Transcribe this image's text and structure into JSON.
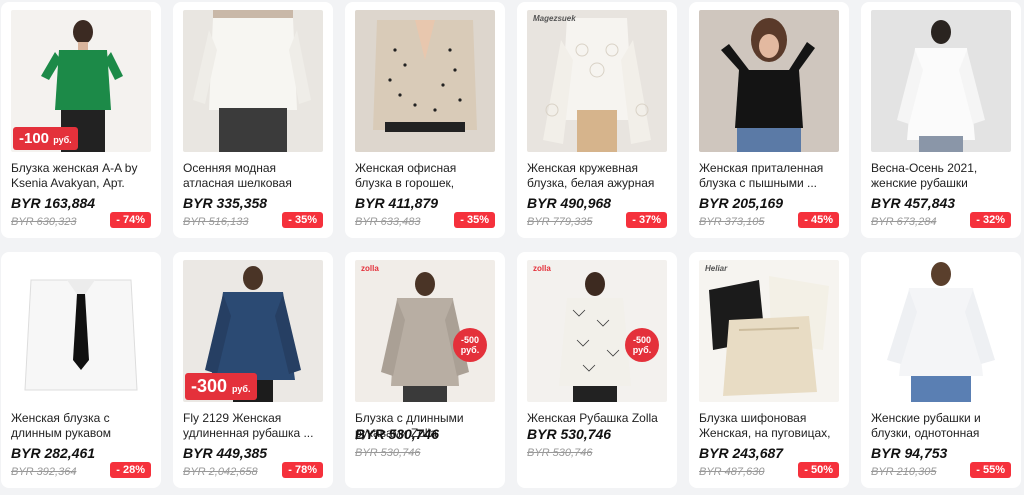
{
  "products": [
    {
      "title": "Блузка женская A-A by Ksenia Avakyan, Арт. ФА-...",
      "price": "BYR 163,884",
      "old_price": "BYR 630,323",
      "discount": "- 74%",
      "promo": "-100",
      "promo_sub": "руб."
    },
    {
      "title": "Осенняя модная атласная шелковая рубашка на ...",
      "price": "BYR 335,358",
      "old_price": "BYR 516,133",
      "discount": "- 35%"
    },
    {
      "title": "Женская офисная блузка в горошек, хлопковая ...",
      "price": "BYR 411,879",
      "old_price": "BYR 633,483",
      "discount": "- 35%"
    },
    {
      "title": "Женская кружевная блузка, белая ажурная блузка ...",
      "price": "BYR 490,968",
      "old_price": "BYR 779,335",
      "discount": "- 37%",
      "brand": "Magezsuek"
    },
    {
      "title": "Женская приталенная блузка с пышными ...",
      "price": "BYR 205,169",
      "old_price": "BYR 373,105",
      "discount": "- 45%"
    },
    {
      "title": "Весна-Осень 2021, женские рубашки Beiyingni, белые ...",
      "price": "BYR 457,843",
      "old_price": "BYR 673,284",
      "discount": "- 32%"
    },
    {
      "title": "Женская блузка с длинным рукавом EBAIHUI, ...",
      "price": "BYR 282,461",
      "old_price": "BYR 392,364",
      "discount": "- 28%"
    },
    {
      "title": "Fly 2129 Женская удлиненная рубашка ...",
      "price": "BYR 449,385",
      "old_price": "BYR 2,042,658",
      "discount": "- 78%",
      "promo": "-300",
      "promo_sub": "руб."
    },
    {
      "title": "Блузка с длинными рукавами Zolla",
      "price": "BYR 530,746",
      "old_price": "BYR 530,746",
      "brand": "zolla",
      "bubble": "-500",
      "bubble_sub": "руб."
    },
    {
      "title": "Женская Рубашка Zolla",
      "price": "BYR 530,746",
      "old_price": "BYR 530,746",
      "brand": "zolla",
      "bubble": "-500",
      "bubble_sub": "руб."
    },
    {
      "title": "Блузка шифоновая Женская, на пуговицах, с ...",
      "price": "BYR 243,687",
      "old_price": "BYR 487,630",
      "discount": "- 50%",
      "brand": "Heliar"
    },
    {
      "title": "Женские рубашки и блузки, однотонная Свободная ...",
      "price": "BYR 94,753",
      "old_price": "BYR 210,305",
      "discount": "- 55%"
    }
  ],
  "colors": {
    "accent": "#f5313c",
    "background": "#f2f3f5"
  }
}
